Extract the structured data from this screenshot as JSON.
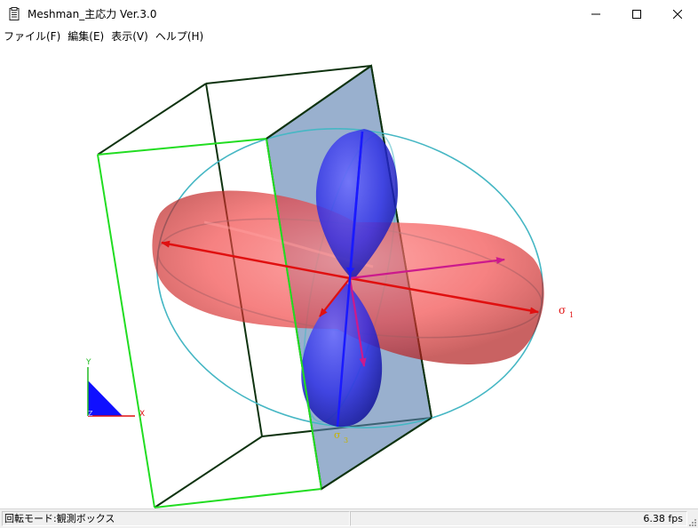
{
  "window": {
    "title": "Meshman_主応力 Ver.3.0"
  },
  "menu": [
    {
      "label": "ファイル(F)"
    },
    {
      "label": "編集(E)"
    },
    {
      "label": "表示(V)"
    },
    {
      "label": "ヘルプ(H)"
    }
  ],
  "viewport": {
    "axis_gizmo": {
      "y_label": "Y",
      "x_label": "X",
      "z_label": "Z"
    },
    "labels": {
      "sigma1": {
        "symbol": "σ",
        "subscript": "1"
      },
      "sigma3": {
        "symbol": "σ",
        "subscript": "3"
      }
    },
    "colors": {
      "sigma1": "#e01010",
      "sigma3": "#1a1aff",
      "sigma2": "#cc1a8c",
      "sphere": "#46b7c4",
      "box_front": "#22dd22",
      "box_back": "#0f3310",
      "plane": "#5a7fb0"
    }
  },
  "status": {
    "mode": "回転モード:観測ボックス",
    "fps": "6.38 fps"
  }
}
